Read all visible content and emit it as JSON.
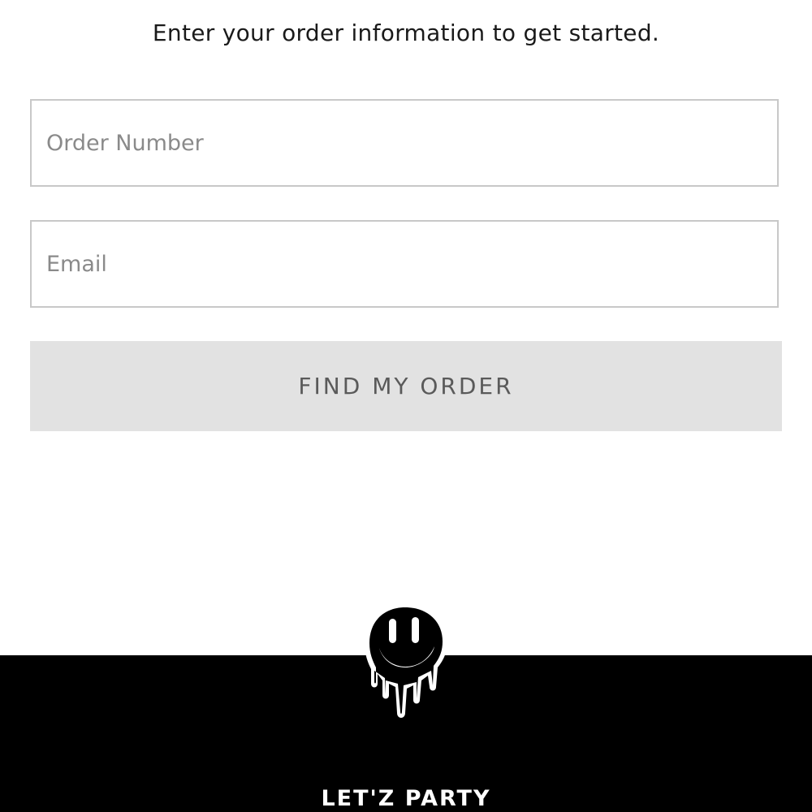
{
  "intro": {
    "text": "Enter your order information to get started."
  },
  "form": {
    "order_number": {
      "value": "",
      "placeholder": "Order Number"
    },
    "email": {
      "value": "",
      "placeholder": "Email"
    },
    "submit_label": "FIND MY ORDER"
  },
  "footer": {
    "logo_icon": "dripping-smiley-icon",
    "brand": "LET'Z PARTY"
  },
  "colors": {
    "button_bg": "#e2e2e2",
    "button_text": "#5a5a5a",
    "field_border": "#c8c8c8",
    "footer_bg": "#000000",
    "text": "#1a1a1a"
  }
}
